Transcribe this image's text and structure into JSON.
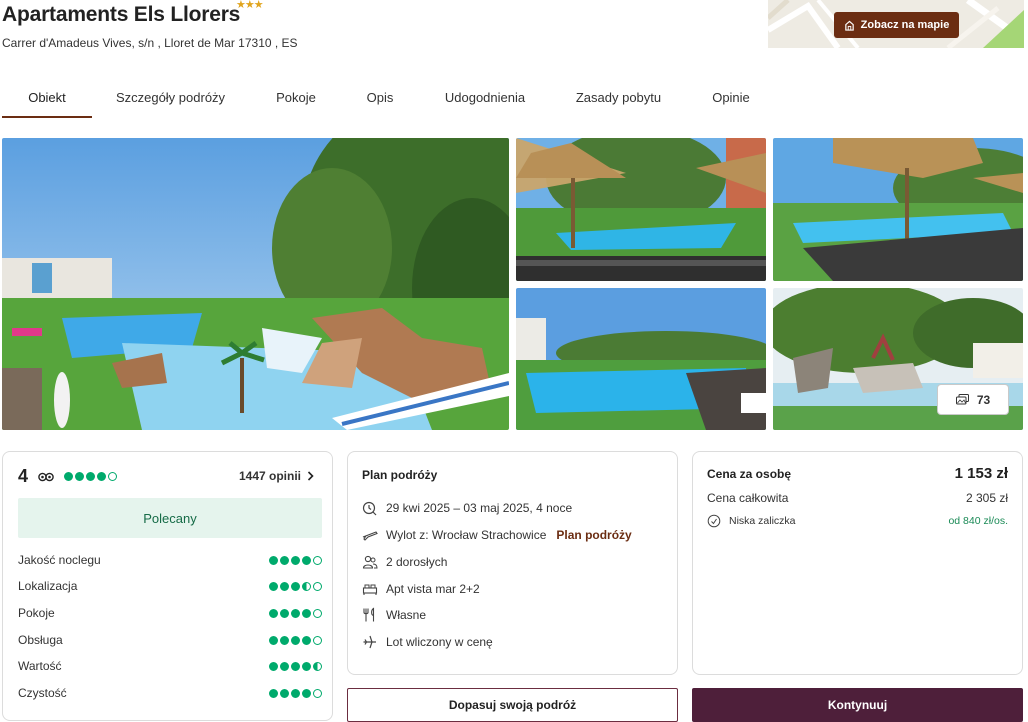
{
  "hotel": {
    "name": "Apartaments Els Llorers",
    "stars_text": "★★★",
    "address": "Carrer d'Amadeus Vives, s/n , Lloret de Mar 17310 , ES"
  },
  "map": {
    "button_label": "Zobacz na mapie",
    "icon": "house-icon"
  },
  "tabs": [
    {
      "label": "Obiekt",
      "active": true
    },
    {
      "label": "Szczegóły podróży",
      "active": false
    },
    {
      "label": "Pokoje",
      "active": false
    },
    {
      "label": "Opis",
      "active": false
    },
    {
      "label": "Udogodnienia",
      "active": false
    },
    {
      "label": "Zasady pobytu",
      "active": false
    },
    {
      "label": "Opinie",
      "active": false
    }
  ],
  "gallery": {
    "photo_count": "73",
    "count_icon": "photos-icon"
  },
  "rating": {
    "score": "4",
    "overall_dots": 4,
    "reviews_label": "1447 opinii",
    "badge": "Polecany",
    "categories": [
      {
        "label": "Jakość noclegu",
        "value": 4
      },
      {
        "label": "Lokalizacja",
        "value": 3.5
      },
      {
        "label": "Pokoje",
        "value": 4
      },
      {
        "label": "Obsługa",
        "value": 4
      },
      {
        "label": "Wartość",
        "value": 4.5
      },
      {
        "label": "Czystość",
        "value": 4
      }
    ],
    "colors": {
      "dot": "#00aa6c",
      "badge_bg": "#e5f4ed"
    }
  },
  "plan": {
    "title": "Plan podróży",
    "dates": "29 kwi 2025 – 03 maj 2025, 4 noce",
    "departure": "Wylot z: Wrocław Strachowice",
    "departure_link": "Plan podróży",
    "travelers": "2 dorosłych",
    "room": "Apt vista mar 2+2",
    "board": "Własne",
    "flight": "Lot wliczony w cenę"
  },
  "price": {
    "per_person_label": "Cena za osobę",
    "per_person_value": "1 153 zł",
    "total_label": "Cena całkowita",
    "total_value": "2 305 zł",
    "deposit_label": "Niska zaliczka",
    "deposit_value": "od 840 zł/os."
  },
  "actions": {
    "customize": "Dopasuj swoją podróż",
    "continue": "Kontynuuj"
  },
  "colors": {
    "brand": "#6b2d12",
    "primary_button": "#4e1f3a",
    "deposit_green": "#1a8a56"
  }
}
